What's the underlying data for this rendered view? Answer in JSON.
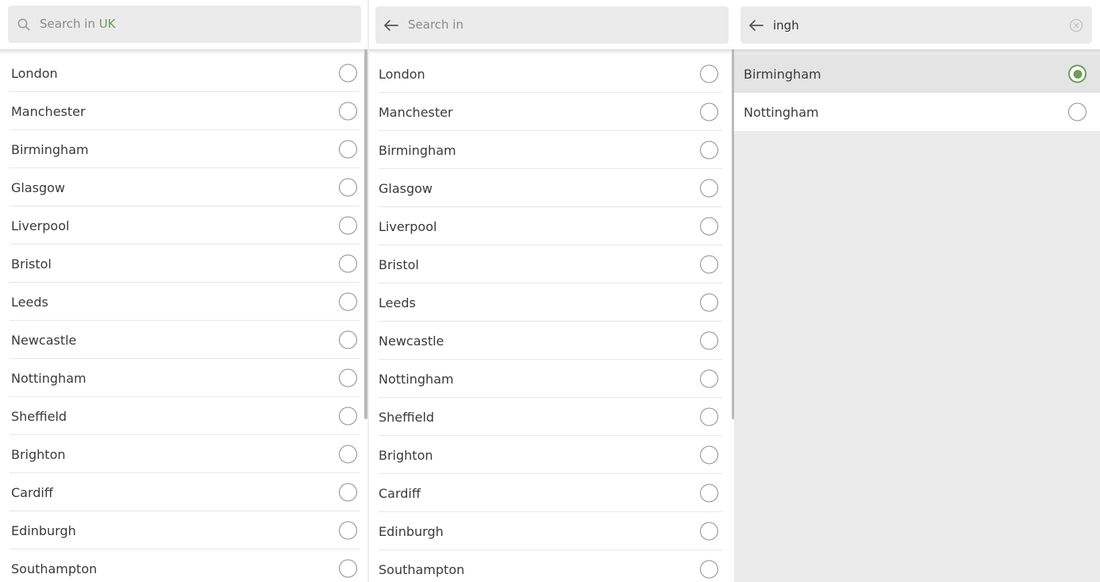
{
  "panel1": {
    "search": {
      "placeholder_prefix": "Search in ",
      "scope": "UK",
      "icon": "search-icon"
    },
    "cities": [
      "London",
      "Manchester",
      "Birmingham",
      "Glasgow",
      "Liverpool",
      "Bristol",
      "Leeds",
      "Newcastle",
      "Nottingham",
      "Sheffield",
      "Brighton",
      "Cardiff",
      "Edinburgh",
      "Southampton"
    ]
  },
  "panel2": {
    "search": {
      "placeholder": "Search in",
      "icon": "back-arrow-icon"
    },
    "cities": [
      "London",
      "Manchester",
      "Birmingham",
      "Glasgow",
      "Liverpool",
      "Bristol",
      "Leeds",
      "Newcastle",
      "Nottingham",
      "Sheffield",
      "Brighton",
      "Cardiff",
      "Edinburgh",
      "Southampton"
    ]
  },
  "panel3": {
    "search": {
      "query": "ingh",
      "icon": "back-arrow-icon",
      "clear_icon": "clear-icon"
    },
    "results": [
      "Birmingham",
      "Nottingham"
    ],
    "selected": "Birmingham"
  },
  "colors": {
    "accent": "#6c9c56",
    "field_bg": "#ebebec",
    "divider": "#e6e6e6",
    "radio_border": "#8e8e8e"
  }
}
